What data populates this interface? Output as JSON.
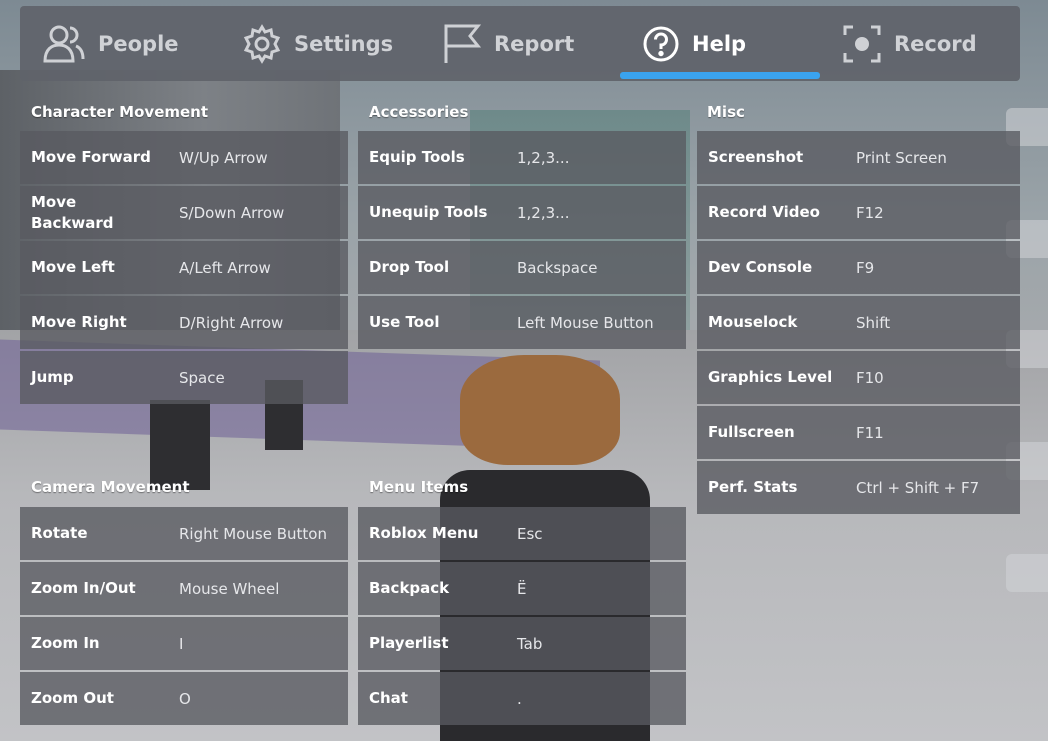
{
  "tabs": [
    {
      "label": "People",
      "icon": "people-icon",
      "active": false
    },
    {
      "label": "Settings",
      "icon": "gear-icon",
      "active": false
    },
    {
      "label": "Report",
      "icon": "flag-icon",
      "active": false
    },
    {
      "label": "Help",
      "icon": "question-icon",
      "active": true
    },
    {
      "label": "Record",
      "icon": "record-icon",
      "active": false
    }
  ],
  "accent_color": "#3aa3ef",
  "sections": {
    "character_movement": {
      "title": "Character Movement",
      "rows": [
        {
          "action": "Move Forward",
          "key": "W/Up Arrow"
        },
        {
          "action": "Move Backward",
          "key": "S/Down Arrow"
        },
        {
          "action": "Move Left",
          "key": "A/Left Arrow"
        },
        {
          "action": "Move Right",
          "key": "D/Right Arrow"
        },
        {
          "action": "Jump",
          "key": "Space"
        }
      ]
    },
    "accessories": {
      "title": "Accessories",
      "rows": [
        {
          "action": "Equip Tools",
          "key": "1,2,3..."
        },
        {
          "action": "Unequip Tools",
          "key": "1,2,3..."
        },
        {
          "action": "Drop Tool",
          "key": "Backspace"
        },
        {
          "action": "Use Tool",
          "key": "Left Mouse Button"
        }
      ]
    },
    "misc": {
      "title": "Misc",
      "rows": [
        {
          "action": "Screenshot",
          "key": "Print Screen"
        },
        {
          "action": "Record Video",
          "key": "F12"
        },
        {
          "action": "Dev Console",
          "key": "F9"
        },
        {
          "action": "Mouselock",
          "key": "Shift"
        },
        {
          "action": "Graphics Level",
          "key": "F10"
        },
        {
          "action": "Fullscreen",
          "key": "F11"
        },
        {
          "action": "Perf. Stats",
          "key": "Ctrl + Shift + F7"
        }
      ]
    },
    "camera_movement": {
      "title": "Camera Movement",
      "rows": [
        {
          "action": "Rotate",
          "key": "Right Mouse Button"
        },
        {
          "action": "Zoom In/Out",
          "key": "Mouse Wheel"
        },
        {
          "action": "Zoom In",
          "key": "I"
        },
        {
          "action": "Zoom Out",
          "key": "O"
        }
      ]
    },
    "menu_items": {
      "title": "Menu Items",
      "rows": [
        {
          "action": "Roblox Menu",
          "key": "Esc"
        },
        {
          "action": "Backpack",
          "key": "Ë"
        },
        {
          "action": "Playerlist",
          "key": "Tab"
        },
        {
          "action": "Chat",
          "key": "."
        }
      ]
    }
  }
}
